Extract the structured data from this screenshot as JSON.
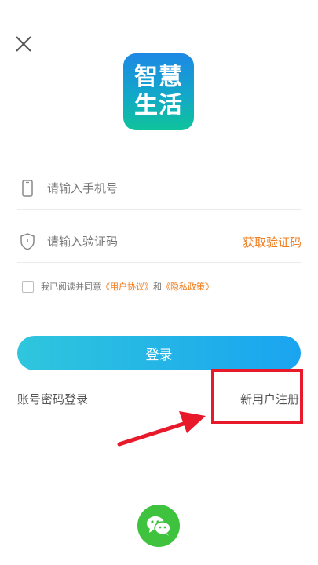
{
  "logo": {
    "line1": "智慧",
    "line2": "生活"
  },
  "phone": {
    "placeholder": "请输入手机号",
    "value": ""
  },
  "code": {
    "placeholder": "请输入验证码",
    "value": "",
    "get_code_label": "获取验证码"
  },
  "agreement": {
    "prefix": "我已阅读并同意",
    "user_agreement": "《用户协议》",
    "and": "和",
    "privacy_policy": "《隐私政策》",
    "checked": false
  },
  "login_label": "登录",
  "password_login_label": "账号密码登录",
  "register_label": "新用户注册",
  "colors": {
    "accent": "#f07c1e",
    "button_start": "#2fc6dd",
    "button_end": "#1aa4f0",
    "highlight": "#e8192b",
    "wechat": "#3fc33f"
  },
  "icons": [
    "close-icon",
    "phone-icon",
    "shield-icon",
    "wechat-icon",
    "pointer-arrow"
  ]
}
